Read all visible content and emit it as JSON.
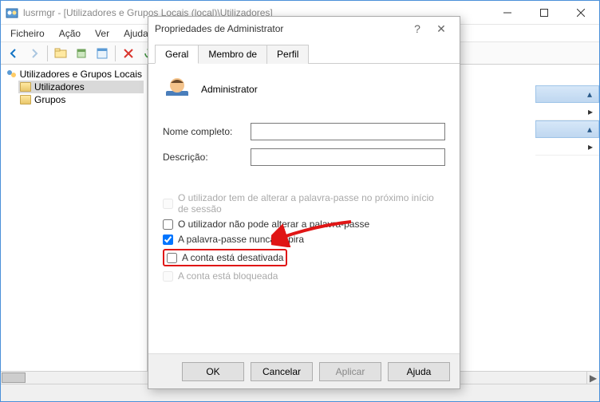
{
  "window": {
    "title": "lusrmgr - [Utilizadores e Grupos Locais (local)\\Utilizadores]"
  },
  "menu": {
    "file": "Ficheiro",
    "action": "Ação",
    "view": "Ver",
    "help": "Ajuda"
  },
  "tree": {
    "root": "Utilizadores e Grupos Locais",
    "users": "Utilizadores",
    "groups": "Grupos"
  },
  "dialog": {
    "title": "Propriedades de Administrator",
    "tabs": {
      "general": "Geral",
      "member": "Membro de",
      "profile": "Perfil"
    },
    "username": "Administrator",
    "fullname_label": "Nome completo:",
    "fullname_value": "",
    "desc_label": "Descrição:",
    "desc_value": "",
    "chk_must_change": "O utilizador tem de alterar a palavra-passe no próximo início de sessão",
    "chk_cannot_change": "O utilizador não pode alterar a palavra-passe",
    "chk_never_expires": "A palavra-passe nunca expira",
    "chk_disabled": "A conta está desativada",
    "chk_locked": "A conta está bloqueada",
    "buttons": {
      "ok": "OK",
      "cancel": "Cancelar",
      "apply": "Aplicar",
      "help": "Ajuda"
    }
  }
}
